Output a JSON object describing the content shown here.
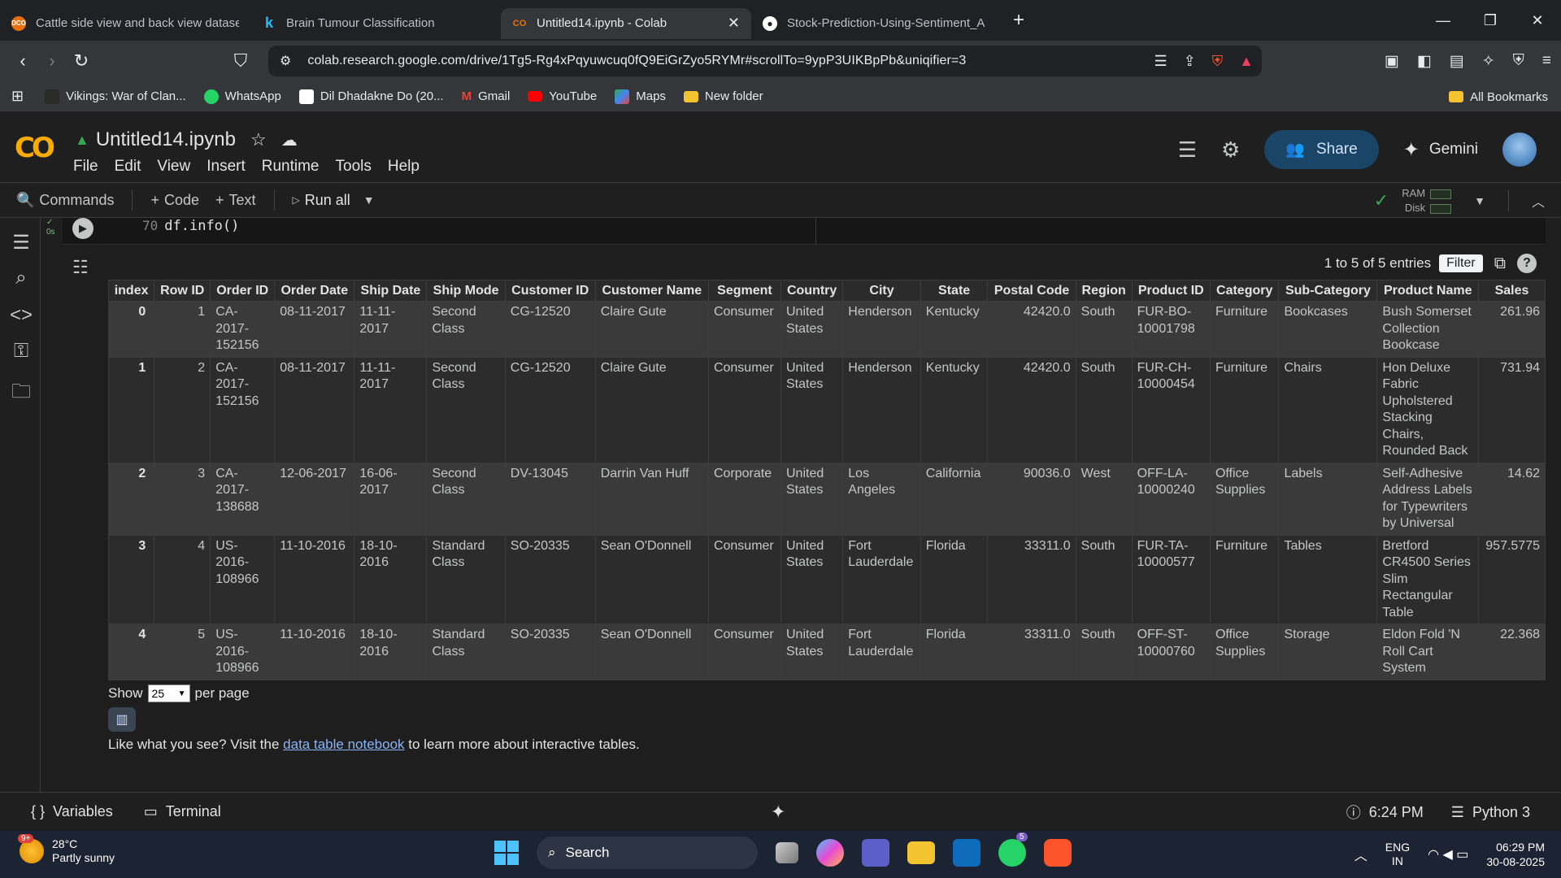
{
  "browser": {
    "tabs": [
      {
        "title": "Cattle side view and back view datase",
        "fav_color": "#e8710a",
        "fav_text": "DCO"
      },
      {
        "title": "Brain Tumour Classification",
        "fav_color": "#20beff",
        "fav_text": "k"
      },
      {
        "title": "Untitled14.ipynb - Colab",
        "fav_color": "#e8710a",
        "fav_text": "CO",
        "active": true
      },
      {
        "title": "Stock-Prediction-Using-Sentiment_A",
        "fav_color": "#ffffff",
        "fav_text": "●"
      }
    ],
    "url": "colab.research.google.com/drive/1Tg5-Rg4xPqyuwcuq0fQ9EiGrZyo5RYMr#scrollTo=9ypP3UIKBpPb&uniqifier=3",
    "bookmarks": [
      {
        "label": "Vikings: War of Clan...",
        "color": "#202124"
      },
      {
        "label": "WhatsApp",
        "color": "#25d366"
      },
      {
        "label": "Dil Dhadakne Do (20...",
        "color": "#ffffff"
      },
      {
        "label": "Gmail",
        "color": "#ea4335"
      },
      {
        "label": "YouTube",
        "color": "#ff0000"
      },
      {
        "label": "Maps",
        "color": "#34a853"
      },
      {
        "label": "New folder",
        "color": "#f4c430"
      }
    ],
    "all_bookmarks": "All Bookmarks"
  },
  "colab": {
    "notebook_title": "Untitled14.ipynb",
    "menu": [
      "File",
      "Edit",
      "View",
      "Insert",
      "Runtime",
      "Tools",
      "Help"
    ],
    "share_label": "Share",
    "gemini_label": "Gemini",
    "toolbar": {
      "commands": "Commands",
      "code": "Code",
      "text": "Text",
      "run_all": "Run all",
      "ram": "RAM",
      "disk": "Disk"
    }
  },
  "cell": {
    "exec_status": "0s",
    "line_number": "70",
    "code": "df.info()"
  },
  "table": {
    "entries_label": "1 to 5 of 5 entries",
    "filter_label": "Filter",
    "columns": [
      "index",
      "Row ID",
      "Order ID",
      "Order Date",
      "Ship Date",
      "Ship Mode",
      "Customer ID",
      "Customer Name",
      "Segment",
      "Country",
      "City",
      "State",
      "Postal Code",
      "Region",
      "Product ID",
      "Category",
      "Sub-Category",
      "Product Name",
      "Sales"
    ],
    "rows": [
      [
        "0",
        "1",
        "CA-2017-152156",
        "08-11-2017",
        "11-11-2017",
        "Second Class",
        "CG-12520",
        "Claire Gute",
        "Consumer",
        "United States",
        "Henderson",
        "Kentucky",
        "42420.0",
        "South",
        "FUR-BO-10001798",
        "Furniture",
        "Bookcases",
        "Bush Somerset Collection Bookcase",
        "261.96"
      ],
      [
        "1",
        "2",
        "CA-2017-152156",
        "08-11-2017",
        "11-11-2017",
        "Second Class",
        "CG-12520",
        "Claire Gute",
        "Consumer",
        "United States",
        "Henderson",
        "Kentucky",
        "42420.0",
        "South",
        "FUR-CH-10000454",
        "Furniture",
        "Chairs",
        "Hon Deluxe Fabric Upholstered Stacking Chairs, Rounded Back",
        "731.94"
      ],
      [
        "2",
        "3",
        "CA-2017-138688",
        "12-06-2017",
        "16-06-2017",
        "Second Class",
        "DV-13045",
        "Darrin Van Huff",
        "Corporate",
        "United States",
        "Los Angeles",
        "California",
        "90036.0",
        "West",
        "OFF-LA-10000240",
        "Office Supplies",
        "Labels",
        "Self-Adhesive Address Labels for Typewriters by Universal",
        "14.62"
      ],
      [
        "3",
        "4",
        "US-2016-108966",
        "11-10-2016",
        "18-10-2016",
        "Standard Class",
        "SO-20335",
        "Sean O'Donnell",
        "Consumer",
        "United States",
        "Fort Lauderdale",
        "Florida",
        "33311.0",
        "South",
        "FUR-TA-10000577",
        "Furniture",
        "Tables",
        "Bretford CR4500 Series Slim Rectangular Table",
        "957.5775"
      ],
      [
        "4",
        "5",
        "US-2016-108966",
        "11-10-2016",
        "18-10-2016",
        "Standard Class",
        "SO-20335",
        "Sean O'Donnell",
        "Consumer",
        "United States",
        "Fort Lauderdale",
        "Florida",
        "33311.0",
        "South",
        "OFF-ST-10000760",
        "Office Supplies",
        "Storage",
        "Eldon Fold 'N Roll Cart System",
        "22.368"
      ]
    ],
    "show_label": "Show",
    "per_page_value": "25",
    "per_page_label": "per page",
    "like_prefix": "Like what you see? Visit the",
    "like_link": "data table notebook",
    "like_suffix": "to learn more about interactive tables."
  },
  "statusbar": {
    "variables": "Variables",
    "terminal": "Terminal",
    "time": "6:24 PM",
    "runtime": "Python 3"
  },
  "taskbar": {
    "temp": "28°C",
    "weather": "Partly sunny",
    "weather_badge": "9+",
    "search": "Search",
    "lang1": "ENG",
    "lang2": "IN",
    "time": "06:29 PM",
    "date": "30-08-2025",
    "whatsapp_badge": "5"
  }
}
